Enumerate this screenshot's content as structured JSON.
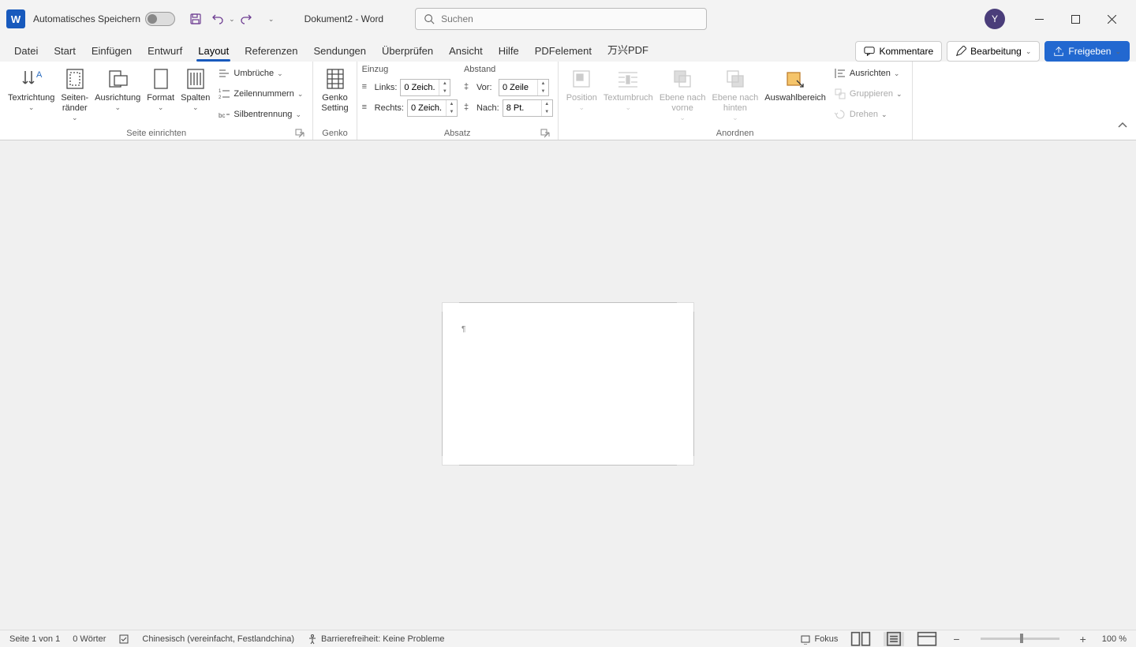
{
  "titlebar": {
    "autosave_label": "Automatisches Speichern",
    "doc_title": "Dokument2  -  Word",
    "search_placeholder": "Suchen",
    "user_initial": "Y"
  },
  "tabs": {
    "items": [
      "Datei",
      "Start",
      "Einfügen",
      "Entwurf",
      "Layout",
      "Referenzen",
      "Sendungen",
      "Überprüfen",
      "Ansicht",
      "Hilfe",
      "PDFelement",
      "万兴PDF"
    ],
    "active_index": 4,
    "comments": "Kommentare",
    "editing": "Bearbeitung",
    "share": "Freigeben"
  },
  "ribbon": {
    "page_setup": {
      "label": "Seite einrichten",
      "text_direction": "Textrichtung",
      "margins": "Seiten-\nränder",
      "orientation": "Ausrichtung",
      "size": "Format",
      "columns": "Spalten",
      "breaks": "Umbrüche",
      "line_numbers": "Zeilennummern",
      "hyphenation": "Silbentrennung"
    },
    "genko": {
      "label": "Genko",
      "setting": "Genko\nSetting"
    },
    "paragraph": {
      "label": "Absatz",
      "indent_head": "Einzug",
      "spacing_head": "Abstand",
      "left": "Links:",
      "right": "Rechts:",
      "before": "Vor:",
      "after": "Nach:",
      "left_val": "0 Zeich.",
      "right_val": "0 Zeich.",
      "before_val": "0 Zeile",
      "after_val": "8 Pt."
    },
    "arrange": {
      "label": "Anordnen",
      "position": "Position",
      "wrap": "Textumbruch",
      "forward": "Ebene nach\nvorne",
      "backward": "Ebene nach\nhinten",
      "selection": "Auswahlbereich",
      "align": "Ausrichten",
      "group": "Gruppieren",
      "rotate": "Drehen"
    }
  },
  "statusbar": {
    "page": "Seite 1 von 1",
    "words": "0 Wörter",
    "language": "Chinesisch (vereinfacht, Festlandchina)",
    "accessibility": "Barrierefreiheit: Keine Probleme",
    "focus": "Fokus",
    "zoom": "100 %"
  }
}
